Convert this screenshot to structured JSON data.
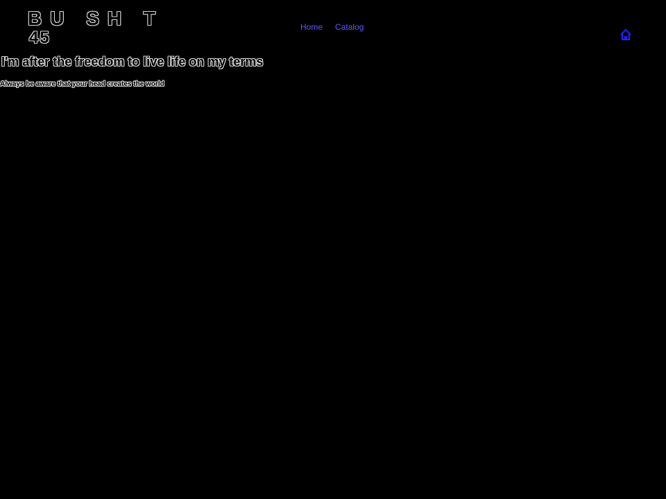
{
  "header": {
    "logo": {
      "line1": "BU SH T",
      "line2": "45"
    },
    "nav": {
      "items": [
        {
          "label": "Home"
        },
        {
          "label": "Catalog"
        }
      ]
    },
    "home_icon": "home-icon"
  },
  "main": {
    "headline": "I'm after the freedom to live life on my terms",
    "tagline": "Always be aware that your head creates the world"
  },
  "colors": {
    "background": "#000000",
    "outline": "#d8d8d8",
    "link": "#5b5bff",
    "icon": "#2222ff"
  }
}
